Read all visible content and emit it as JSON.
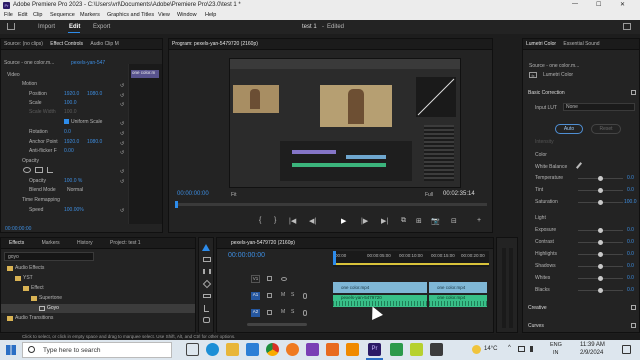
{
  "app": {
    "title": "Adobe Premiere Pro 2023 - C:\\Users\\vrl\\Documents\\Adobe\\Premiere Pro\\23.0\\test 1 *",
    "window_controls": [
      "—",
      "☐",
      "✕"
    ]
  },
  "menu": [
    "File",
    "Edit",
    "Clip",
    "Sequence",
    "Markers",
    "Graphics and Titles",
    "View",
    "Window",
    "Help"
  ],
  "workspace": {
    "tabs": [
      "Import",
      "Edit",
      "Export"
    ],
    "active": "Edit",
    "project_name": "test 1",
    "status": "Edited"
  },
  "effect_controls": {
    "tabs": [
      "Source: (no clips)",
      "Effect Controls",
      "Audio Clip M"
    ],
    "source_label": "Source - one color.m...",
    "sequence_label": "pexels-yan-547",
    "mini_clip": "one color.m",
    "sections": {
      "video": "Video",
      "motion": "Motion",
      "position_label": "Position",
      "position_values": [
        "1920.0",
        "1080.0"
      ],
      "scale_label": "Scale",
      "scale_value": "100.0",
      "scale_width_label": "Scale Width",
      "scale_width_value": "100.0",
      "uniform_scale": "Uniform Scale",
      "rotation_label": "Rotation",
      "rotation_value": "0.0",
      "anchor_label": "Anchor Point",
      "anchor_values": [
        "1920.0",
        "1080.0"
      ],
      "flicker_label": "Anti-flicker F",
      "flicker_value": "0.00",
      "opacity": "Opacity",
      "opacity_label": "Opacity",
      "opacity_value": "100.0 %",
      "blend_label": "Blend Mode",
      "blend_value": "Normal",
      "time_remap": "Time Remapping",
      "speed_label": "Speed",
      "speed_value": "100.00%"
    },
    "timecode": "00:00:00:00"
  },
  "program": {
    "title": "Program: pexels-yan-5479720 (2160p)",
    "timecode_left": "00:00:00:00",
    "fit": "Fit",
    "quality": "Full",
    "timecode_right": "00:02:35:14",
    "transport": [
      "{",
      "}",
      "|◀",
      "◀|",
      "▶",
      "|▶",
      "▶|",
      "⧉",
      "⊞",
      "📷",
      "⊟",
      "+"
    ]
  },
  "effects_panel": {
    "tabs": [
      "Effects",
      "Markers",
      "History",
      "Project: test 1"
    ],
    "search": "goyo",
    "tree": [
      "Audio Effects",
      "YST",
      "Effect",
      "Supertone",
      "Goyo",
      "Audio Transitions"
    ]
  },
  "timeline": {
    "title": "pexels-yan-5479720 (2160p)",
    "timecode": "00:00:00:00",
    "ruler": [
      "00:00",
      "00:00:05:00",
      "00:00:10:00",
      "00:00:15:00",
      "00:00:20:00"
    ],
    "tracks": [
      {
        "name": "V1",
        "type": "video"
      },
      {
        "name": "A1",
        "type": "audio"
      },
      {
        "name": "A2",
        "type": "audio"
      }
    ],
    "clips": {
      "v1a": "one color.mp4",
      "v1b": "one color.mp4",
      "a1": "pexels-yan-5479720",
      "a1b": "one color.mp4"
    }
  },
  "lumetri": {
    "tabs": [
      "Lumetri Color",
      "Essential Sound"
    ],
    "source_label": "Source - one color.m...",
    "color_label": "Lumetri Color",
    "basic_correction": "Basic Correction",
    "input_lut_label": "Input LUT",
    "input_lut_value": "None",
    "auto": "Auto",
    "reset": "Reset",
    "intensity": "Intensity",
    "color_section": "Color",
    "white_balance": "White Balance",
    "color_rows": [
      {
        "label": "Temperature",
        "value": "0.0",
        "level": 0.5
      },
      {
        "label": "Tint",
        "value": "0.0",
        "level": 0.5
      },
      {
        "label": "Saturation",
        "value": "100.0",
        "level": 0.5
      }
    ],
    "light_section": "Light",
    "light_rows": [
      {
        "label": "Exposure",
        "value": "0.0",
        "level": 0.5
      },
      {
        "label": "Contrast",
        "value": "0.0",
        "level": 0.5
      },
      {
        "label": "Highlights",
        "value": "0.0",
        "level": 0.5
      },
      {
        "label": "Shadows",
        "value": "0.0",
        "level": 0.5
      },
      {
        "label": "Whites",
        "value": "0.0",
        "level": 0.5
      },
      {
        "label": "Blacks",
        "value": "0.0",
        "level": 0.5
      }
    ],
    "creative": "Creative",
    "curves": "Curves"
  },
  "status_bar": "Click to select, or click in empty space and drag to marquee select. Use Shift, Alt, and Ctrl for other options.",
  "taskbar": {
    "search_placeholder": "Type here to search",
    "weather": "14°C",
    "lang": "ENG",
    "region": "IN",
    "time": "11:39 AM",
    "date": "2/9/2024"
  },
  "colors": {
    "accent": "#2d8ceb",
    "timecode": "#3d8de0",
    "video_clip": "#7fb7d6",
    "audio_clip": "#38c088"
  }
}
